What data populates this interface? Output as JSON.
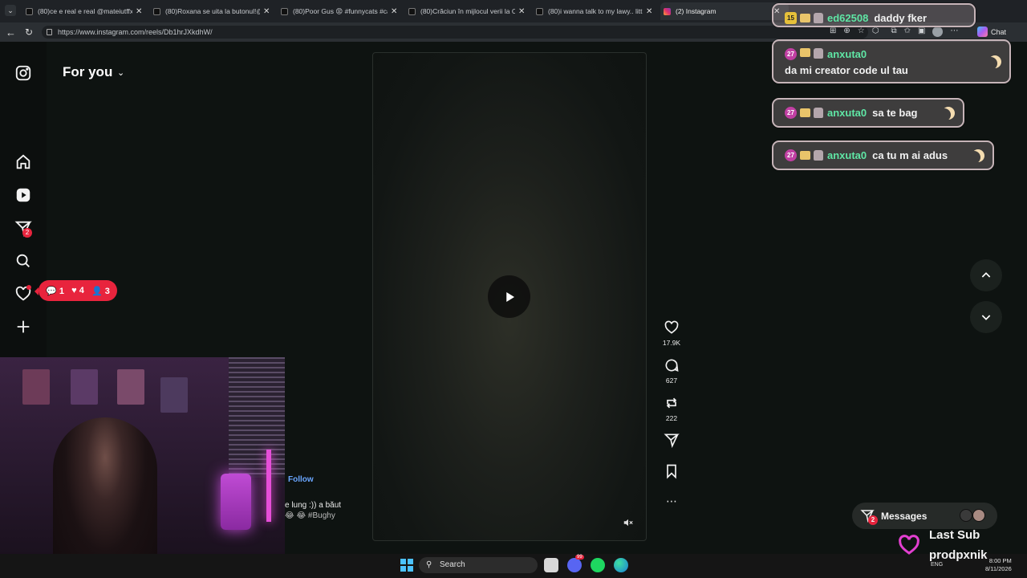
{
  "tabs": [
    {
      "label": "(80)ce e real e real @mateiutffx #f",
      "active": false
    },
    {
      "label": "(80)Roxana se uita la butonul!@ro",
      "active": false
    },
    {
      "label": "(80)Poor Gus 😡 #funnycats #cats",
      "active": false
    },
    {
      "label": "(80)Crăciun în mijlocul verii la Cra",
      "active": false
    },
    {
      "label": "(80)i wanna talk to my lawy.. little",
      "active": false
    },
    {
      "label": "(2) Instagram",
      "active": true
    }
  ],
  "address": {
    "url": "https://www.instagram.com/reels/Db1hrJXkdhW/"
  },
  "browser": {
    "chat_button": "Chat"
  },
  "header": {
    "title": "For you"
  },
  "sidebar": {
    "icons": [
      "instagram-logo-icon",
      "home-icon",
      "reels-icon",
      "messages-icon",
      "search-icon",
      "heart-icon",
      "plus-icon"
    ],
    "messages_badge": "2"
  },
  "notifications": {
    "comments": "1",
    "likes": "4",
    "follows": "3"
  },
  "reel": {
    "likes": "17.9K",
    "comments": "627",
    "reposts": "222",
    "follow_label": "Follow",
    "caption_line1": "e lung :)) a băut",
    "caption_line2": "😂 😂 #Bughy"
  },
  "messages": {
    "label": "Messages",
    "badge": "2"
  },
  "chat": [
    {
      "badge": "15",
      "user": "ed62508",
      "text": "daddy fker"
    },
    {
      "badge": "27",
      "user": "anxuta0",
      "text": "da mi creator code ul tau"
    },
    {
      "badge": "27",
      "user": "anxuta0",
      "text": "sa te bag"
    },
    {
      "badge": "27",
      "user": "anxuta0",
      "text": "ca tu m ai adus"
    }
  ],
  "stream_overlay": {
    "last_sub_label": "Last Sub",
    "last_sub_name": "prodpxnik"
  },
  "taskbar": {
    "search_label": "Search",
    "discord_badge": "99",
    "language": "ENG",
    "time": "8:00 PM",
    "date": "8/11/2026"
  },
  "colors": {
    "accent_red": "#e8243d",
    "chat_username": "#5fe6a5",
    "link_blue": "#6aa6ff"
  }
}
